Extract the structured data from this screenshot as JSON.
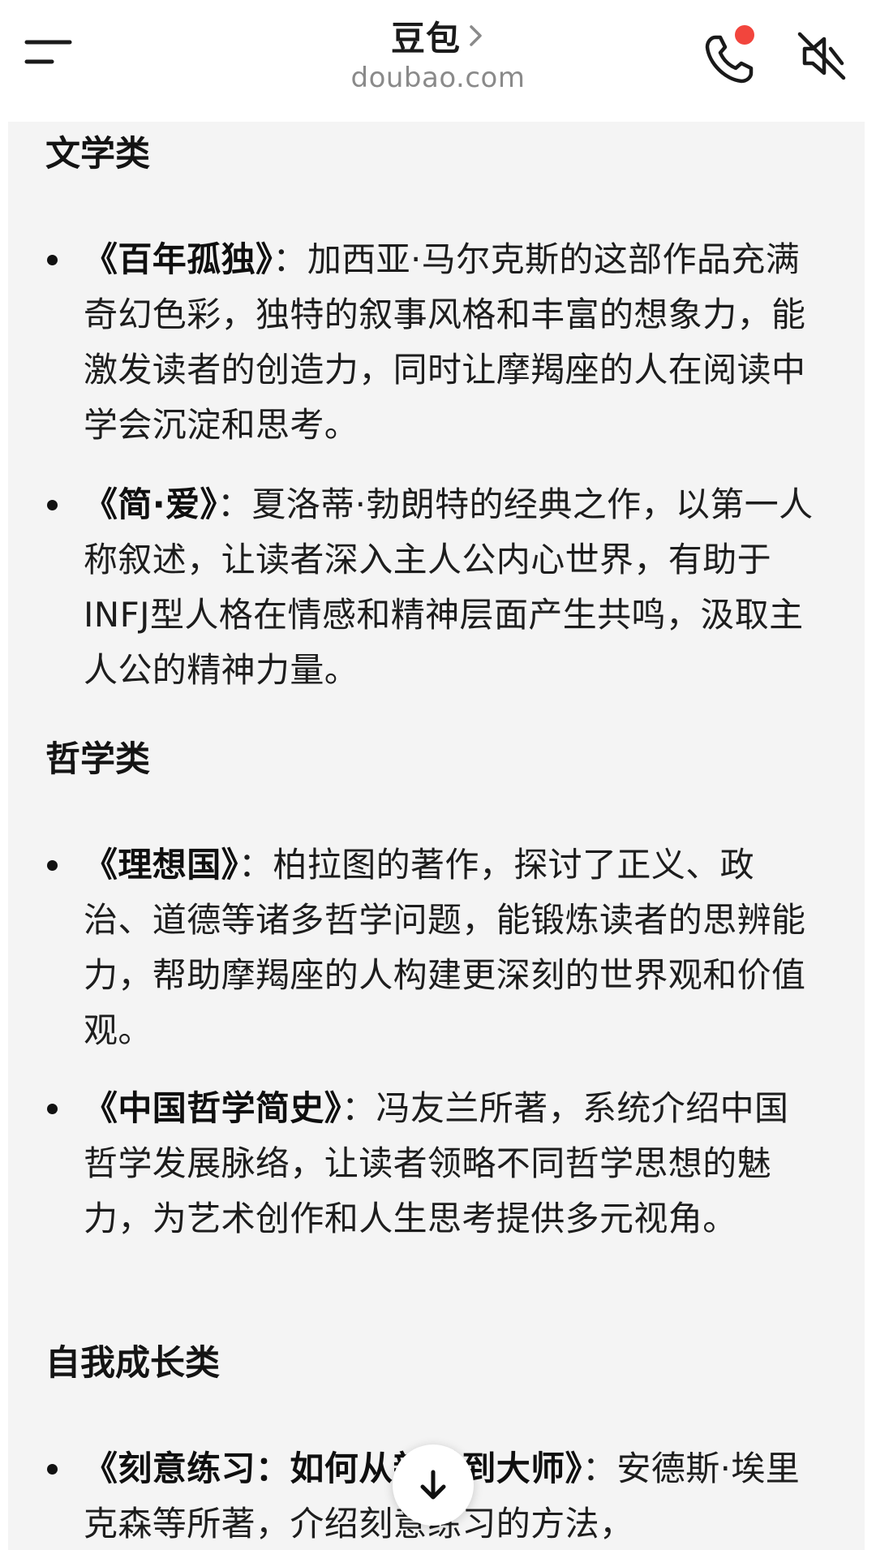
{
  "header": {
    "title": "豆包",
    "url": "doubao.com"
  },
  "icons": {
    "menu": "menu-icon",
    "chevron": "chevron-right-icon",
    "call": "phone-icon",
    "mute": "speaker-muted-icon",
    "scroll": "arrow-down-icon"
  },
  "colors": {
    "notification_dot": "#f2453d",
    "card_background": "#f4f4f4"
  },
  "content": {
    "sections": [
      {
        "heading": "文学类",
        "items": [
          {
            "book": "《百年孤独》",
            "sep": "：",
            "desc": "加西亚·马尔克斯的这部作品充满奇幻色彩，独特的叙事风格和丰富的想象力，能激发读者的创造力，同时让摩羯座的人在阅读中学会沉淀和思考。"
          },
          {
            "book": "《简·爱》",
            "sep": "：",
            "desc": "夏洛蒂·勃朗特的经典之作，以第一人称叙述，让读者深入主人公内心世界，有助于INFJ型人格在情感和精神层面产生共鸣，汲取主人公的精神力量。"
          }
        ]
      },
      {
        "heading": "哲学类",
        "items": [
          {
            "book": "《理想国》",
            "sep": "：",
            "desc": "柏拉图的著作，探讨了正义、政治、道德等诸多哲学问题，能锻炼读者的思辨能力，帮助摩羯座的人构建更深刻的世界观和价值观。"
          },
          {
            "book": "《中国哲学简史》",
            "sep": "：",
            "desc": "冯友兰所著，系统介绍中国哲学发展脉络，让读者领略不同哲学思想的魅力，为艺术创作和人生思考提供多元视角。"
          }
        ]
      },
      {
        "heading": "自我成长类",
        "items": [
          {
            "book": "《刻意练习：如何从新手到大师》",
            "sep": "：",
            "desc": "安德斯·埃里克森等所著，介绍刻意练习的方法，"
          }
        ]
      }
    ]
  }
}
